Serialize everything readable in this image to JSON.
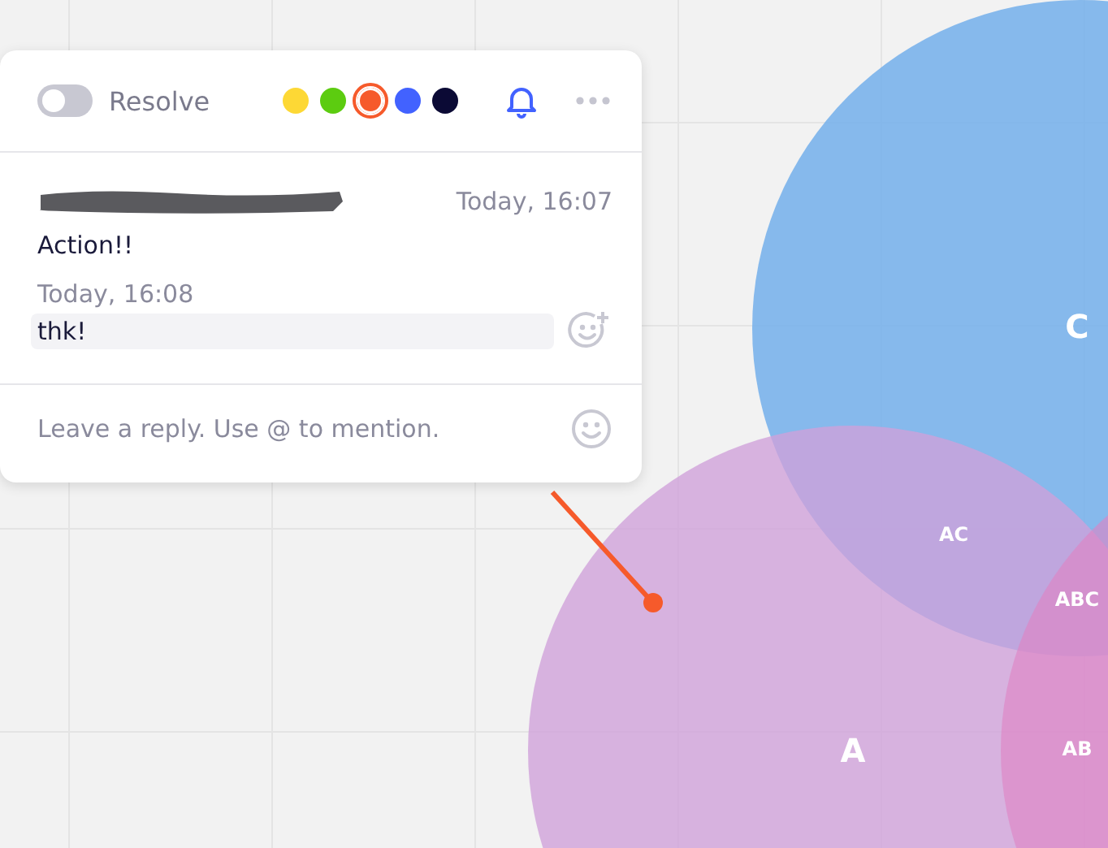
{
  "comment": {
    "resolve": {
      "label": "Resolve",
      "on": false
    },
    "colors": [
      {
        "color": "#fdd835",
        "selected": false
      },
      {
        "color": "#5ccc10",
        "selected": false
      },
      {
        "color": "#f65a2b",
        "selected": true
      },
      {
        "color": "#4262ff",
        "selected": false
      },
      {
        "color": "#0b0a35",
        "selected": false
      }
    ],
    "messages": [
      {
        "kind": "post",
        "time": "Today, 16:07",
        "text": "Action!!",
        "highlighted": false
      },
      {
        "kind": "reply",
        "time": "Today, 16:08",
        "text": "thk!",
        "highlighted": true
      }
    ],
    "reply": {
      "placeholder": "Leave a reply. Use @ to mention."
    }
  },
  "diagram": {
    "circles": [
      {
        "label": "C"
      },
      {
        "label": "A"
      }
    ],
    "overlaps": [
      {
        "label": "AC"
      },
      {
        "label": "ABC"
      },
      {
        "label": "AB"
      }
    ]
  }
}
